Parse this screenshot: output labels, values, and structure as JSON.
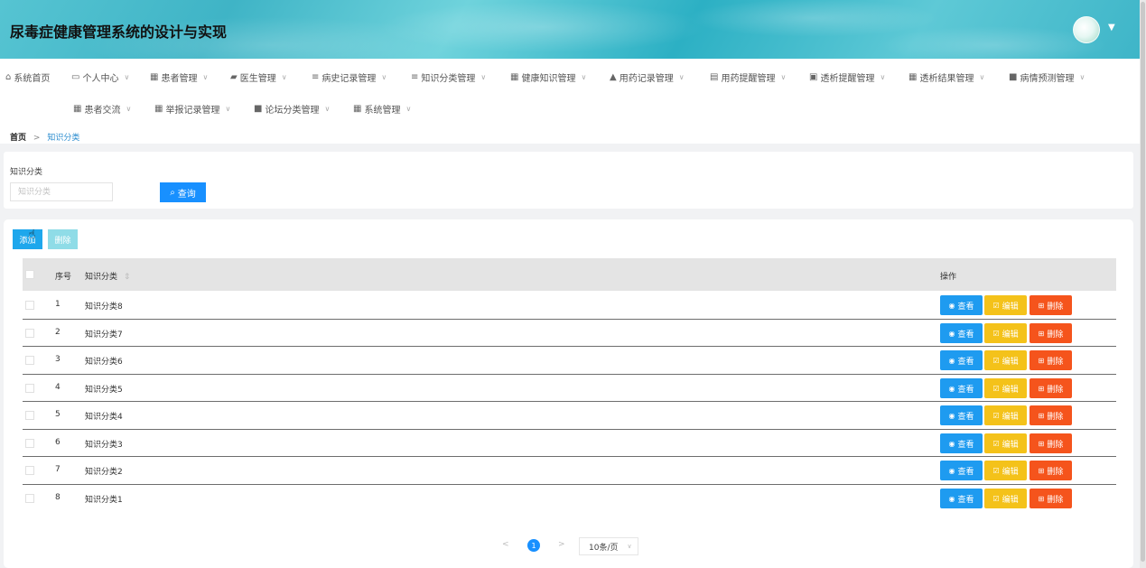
{
  "app": {
    "title": "尿毒症健康管理系统的设计与实现"
  },
  "nav": {
    "items": [
      {
        "label": "系统首页",
        "icon": "home-icon",
        "glyph": "⌂",
        "dropdown": false
      },
      {
        "label": "个人中心",
        "icon": "card-icon",
        "glyph": "▭",
        "dropdown": true
      },
      {
        "label": "患者管理",
        "icon": "grid-icon",
        "glyph": "▦",
        "dropdown": true
      },
      {
        "label": "医生管理",
        "icon": "briefcase-icon",
        "glyph": "▰",
        "dropdown": true
      },
      {
        "label": "病史记录管理",
        "icon": "list-icon",
        "glyph": "≡",
        "dropdown": true
      },
      {
        "label": "知识分类管理",
        "icon": "list-icon",
        "glyph": "≡",
        "dropdown": true
      },
      {
        "label": "健康知识管理",
        "icon": "grid-icon",
        "glyph": "▦",
        "dropdown": true
      },
      {
        "label": "用药记录管理",
        "icon": "thumb-icon",
        "glyph": "▲",
        "dropdown": true
      },
      {
        "label": "用药提醒管理",
        "icon": "clipboard-icon",
        "glyph": "▤",
        "dropdown": true
      },
      {
        "label": "透析提醒管理",
        "icon": "calendar-icon",
        "glyph": "▣",
        "dropdown": true
      },
      {
        "label": "透析结果管理",
        "icon": "grid-icon",
        "glyph": "▦",
        "dropdown": true
      },
      {
        "label": "病情预测管理",
        "icon": "chat-icon",
        "glyph": "■",
        "dropdown": true
      },
      {
        "label": "患者交流",
        "icon": "grid-icon",
        "glyph": "▦",
        "dropdown": true
      },
      {
        "label": "举报记录管理",
        "icon": "table-icon",
        "glyph": "▦",
        "dropdown": true
      },
      {
        "label": "论坛分类管理",
        "icon": "chat-icon",
        "glyph": "■",
        "dropdown": true
      },
      {
        "label": "系统管理",
        "icon": "grid-icon",
        "glyph": "▦",
        "dropdown": true
      }
    ]
  },
  "breadcrumb": {
    "home": "首页",
    "separator": ">",
    "current": "知识分类"
  },
  "search": {
    "label": "知识分类",
    "placeholder": "知识分类",
    "value": "",
    "button_label": "查询",
    "button_icon": "search-icon"
  },
  "toolbar": {
    "add_label": "添加",
    "delete_label": "删除"
  },
  "table": {
    "columns": {
      "index": "序号",
      "category": "知识分类",
      "sort_icon": "⇕",
      "actions": "操作"
    },
    "rows": [
      {
        "index": "1",
        "category": "知识分类8"
      },
      {
        "index": "2",
        "category": "知识分类7"
      },
      {
        "index": "3",
        "category": "知识分类6"
      },
      {
        "index": "4",
        "category": "知识分类5"
      },
      {
        "index": "5",
        "category": "知识分类4"
      },
      {
        "index": "6",
        "category": "知识分类3"
      },
      {
        "index": "7",
        "category": "知识分类2"
      },
      {
        "index": "8",
        "category": "知识分类1"
      }
    ],
    "actions": {
      "view": {
        "label": "查看",
        "icon": "eye-icon",
        "glyph": "◉",
        "color": "#1e9bf0"
      },
      "edit": {
        "label": "编辑",
        "icon": "edit-icon",
        "glyph": "☑",
        "color": "#f4c21a"
      },
      "delete": {
        "label": "删除",
        "icon": "trash-icon",
        "glyph": "⊞",
        "color": "#f5541c"
      }
    }
  },
  "pagination": {
    "prev": "<",
    "current": "1",
    "next": ">",
    "page_size": "10条/页"
  },
  "colors": {
    "primary": "#1890ff",
    "header_teal": "#3fb4c6"
  }
}
